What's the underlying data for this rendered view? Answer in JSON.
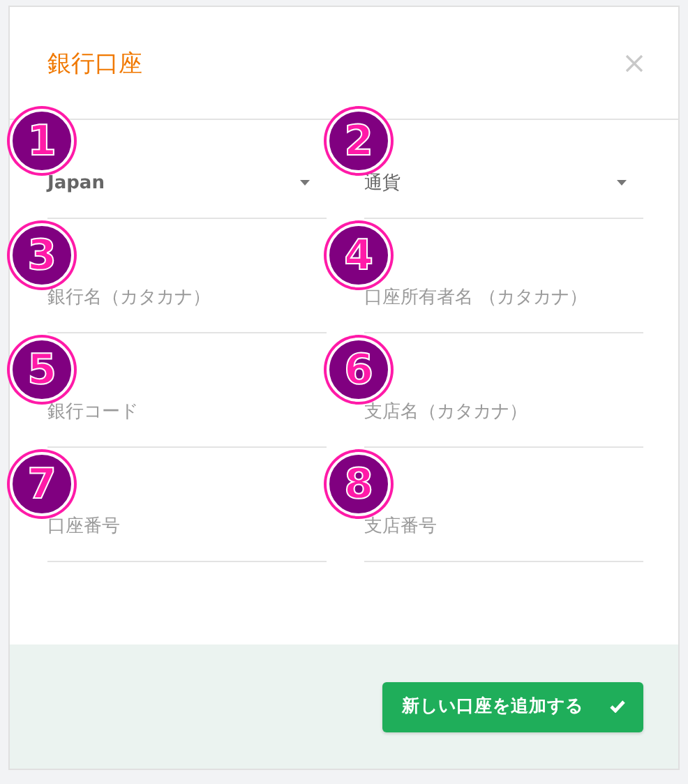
{
  "dialog": {
    "title": "銀行口座"
  },
  "fields": [
    {
      "kind": "select",
      "value": "Japan",
      "marker": "1"
    },
    {
      "kind": "select",
      "placeholder": "通貨",
      "marker": "2"
    },
    {
      "kind": "input",
      "placeholder": "銀行名（カタカナ）",
      "marker": "3"
    },
    {
      "kind": "input",
      "placeholder": "口座所有者名 （カタカナ）",
      "marker": "4"
    },
    {
      "kind": "input",
      "placeholder": "銀行コード",
      "marker": "5"
    },
    {
      "kind": "input",
      "placeholder": "支店名（カタカナ）",
      "marker": "6"
    },
    {
      "kind": "input",
      "placeholder": "口座番号",
      "marker": "7"
    },
    {
      "kind": "input",
      "placeholder": "支店番号",
      "marker": "8"
    }
  ],
  "footer": {
    "button": "新しい口座を追加する"
  }
}
